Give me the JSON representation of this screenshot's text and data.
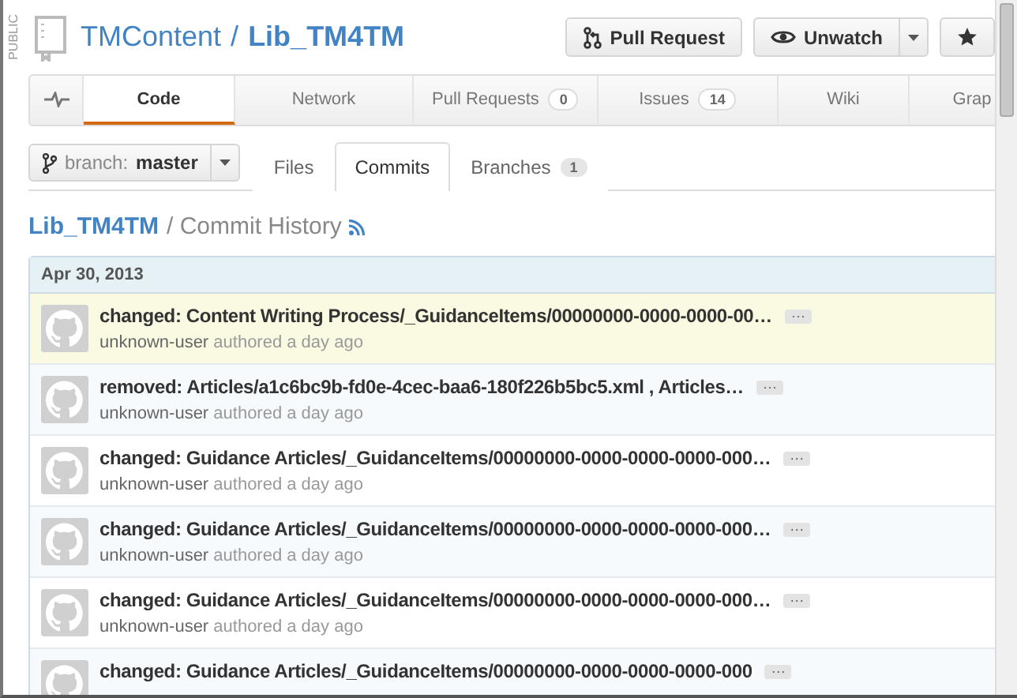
{
  "repo": {
    "visibility": "PUBLIC",
    "owner": "TMContent",
    "separator": "/",
    "name": "Lib_TM4TM"
  },
  "actions": [
    {
      "kind": "pull",
      "label": "Pull Request"
    },
    {
      "kind": "watch",
      "label": "Unwatch"
    },
    {
      "kind": "star"
    }
  ],
  "nav": [
    {
      "kind": "pulse",
      "selected": false
    },
    {
      "kind": "text",
      "label": "Code",
      "selected": true
    },
    {
      "kind": "text",
      "label": "Network",
      "selected": false
    },
    {
      "kind": "text",
      "label": "Pull Requests",
      "count": "0",
      "selected": false
    },
    {
      "kind": "text",
      "label": "Issues",
      "count": "14",
      "selected": false
    },
    {
      "kind": "text",
      "label": "Wiki",
      "selected": false
    },
    {
      "kind": "text",
      "label": "Grap",
      "selected": false
    }
  ],
  "branch": {
    "prefix": "branch:",
    "name": "master"
  },
  "subtabs": [
    {
      "label": "Files",
      "selected": false
    },
    {
      "label": "Commits",
      "selected": true
    },
    {
      "label": "Branches",
      "count": "1",
      "selected": false
    }
  ],
  "heading": {
    "repo": "Lib_TM4TM",
    "title": "/ Commit History"
  },
  "commits": {
    "date": "Apr 30, 2013",
    "rows": [
      {
        "message": "changed: Content Writing Process/_GuidanceItems/00000000-0000-0000-00…",
        "author": "unknown-user",
        "meta": "authored a day ago",
        "more": "···",
        "highlighted": true
      },
      {
        "message": "removed: Articles/a1c6bc9b-fd0e-4cec-baa6-180f226b5bc5.xml , Articles…",
        "author": "unknown-user",
        "meta": "authored a day ago",
        "more": "···",
        "highlighted": false
      },
      {
        "message": "changed: Guidance Articles/_GuidanceItems/00000000-0000-0000-0000-000…",
        "author": "unknown-user",
        "meta": "authored a day ago",
        "more": "···",
        "highlighted": false
      },
      {
        "message": "changed: Guidance Articles/_GuidanceItems/00000000-0000-0000-0000-000…",
        "author": "unknown-user",
        "meta": "authored a day ago",
        "more": "···",
        "highlighted": false
      },
      {
        "message": "changed: Guidance Articles/_GuidanceItems/00000000-0000-0000-0000-000…",
        "author": "unknown-user",
        "meta": "authored a day ago",
        "more": "···",
        "highlighted": false
      },
      {
        "message": "changed: Guidance Articles/_GuidanceItems/00000000-0000-0000-0000-000",
        "more": "···",
        "highlighted": false
      }
    ]
  }
}
